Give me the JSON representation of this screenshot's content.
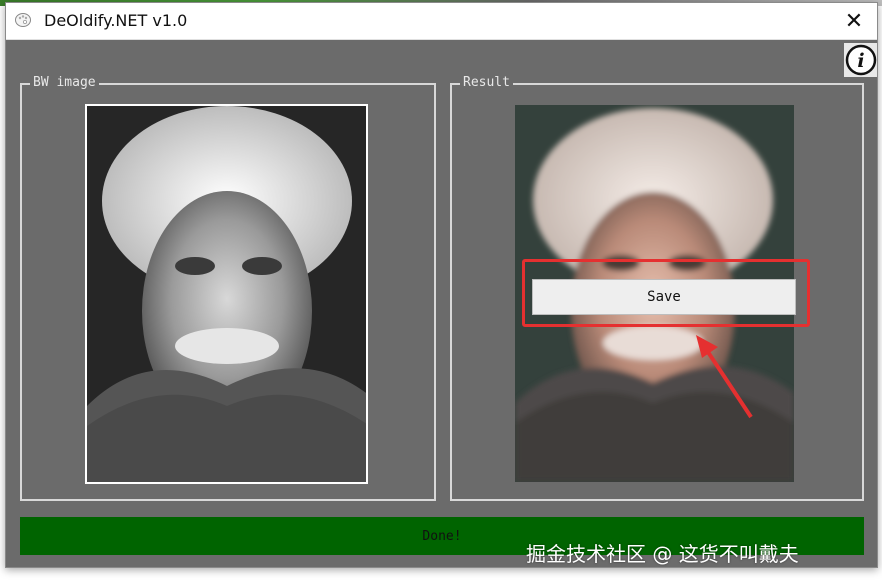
{
  "window": {
    "title": "DeOldify.NET v1.0",
    "close_glyph": "✕"
  },
  "info": {
    "glyph": "i"
  },
  "bw_panel": {
    "label": "BW image"
  },
  "result_panel": {
    "label": "Result",
    "save_label": "Save"
  },
  "status": {
    "text": "Done!",
    "progress": 1.0,
    "color": "#006400"
  },
  "watermark": {
    "text": "掘金技术社区 @ 这货不叫戴夫"
  },
  "colors": {
    "window_bg": "#6b6b6b",
    "highlight": "#e53030"
  }
}
